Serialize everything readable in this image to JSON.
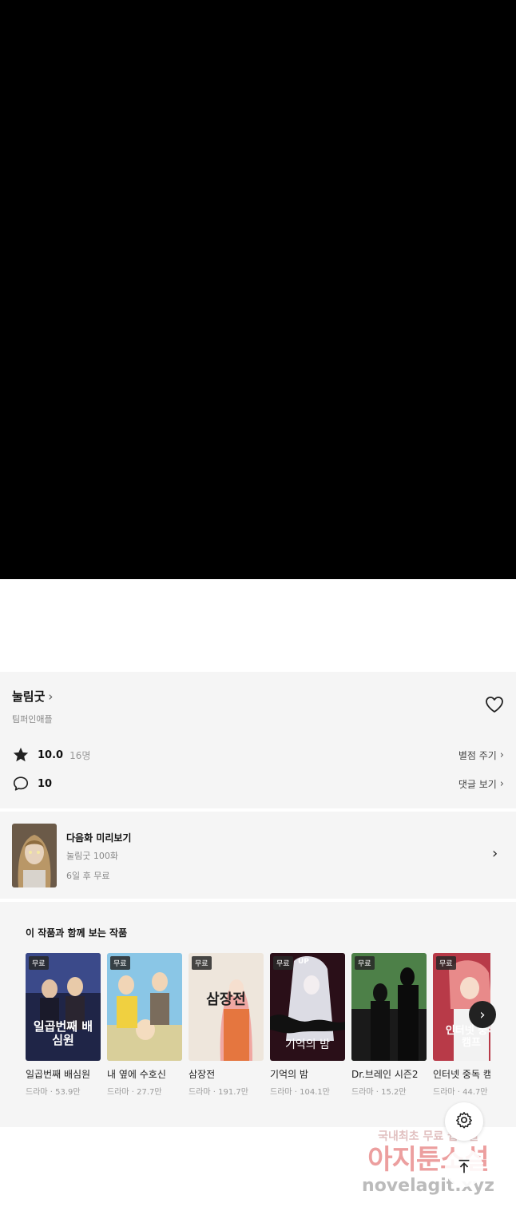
{
  "work": {
    "title": "눌림굿",
    "author": "팀퍼인애플"
  },
  "stats": {
    "rating": "10.0",
    "rating_count": "16명",
    "rate_link": "별점 주기",
    "comments": "10",
    "comments_link": "댓글 보기"
  },
  "next_episode": {
    "title": "다음화 미리보기",
    "subtitle": "눌림굿 100화",
    "free_info": "6일 후 무료"
  },
  "recommendations": {
    "heading": "이 작품과 함께 보는 작품",
    "items": [
      {
        "badge": "무료",
        "name": "일곱번째 배심원",
        "meta": "드라마 · 53.9만",
        "cover_text": "일곱번째 배심원",
        "color": "#2a3560"
      },
      {
        "badge": "무료",
        "name": "내 옆에 수호신",
        "meta": "드라마 · 27.7만",
        "cover_text": "",
        "color": "#8ac6e6"
      },
      {
        "badge": "무료",
        "name": "삼장전",
        "meta": "드라마 · 191.7만",
        "cover_text": "삼장전",
        "color": "#e8d6c8"
      },
      {
        "badge": "무료",
        "badge_up": "UP",
        "name": "기억의 밤",
        "meta": "드라마 · 104.1만",
        "cover_text": "기억의 밤",
        "color": "#3a1620"
      },
      {
        "badge": "무료",
        "name": "Dr.브레인 시즌2",
        "meta": "드라마 · 15.2만",
        "cover_text": "",
        "color": "#3f6a3a"
      },
      {
        "badge": "무료",
        "name": "인터넷 중독 캠프",
        "meta": "드라마 · 44.7만",
        "cover_text": "인터넷 중독 캠프",
        "color": "#c54a55"
      }
    ]
  },
  "watermark": {
    "line1": "국내최초 무료 웹소설",
    "line2": "아지툰소설",
    "line3": "novelagit.xyz"
  },
  "icons": {
    "heart": "heart-icon",
    "star": "star-icon",
    "comment": "comment-icon",
    "settings": "gear-icon",
    "top": "arrow-up-icon"
  }
}
